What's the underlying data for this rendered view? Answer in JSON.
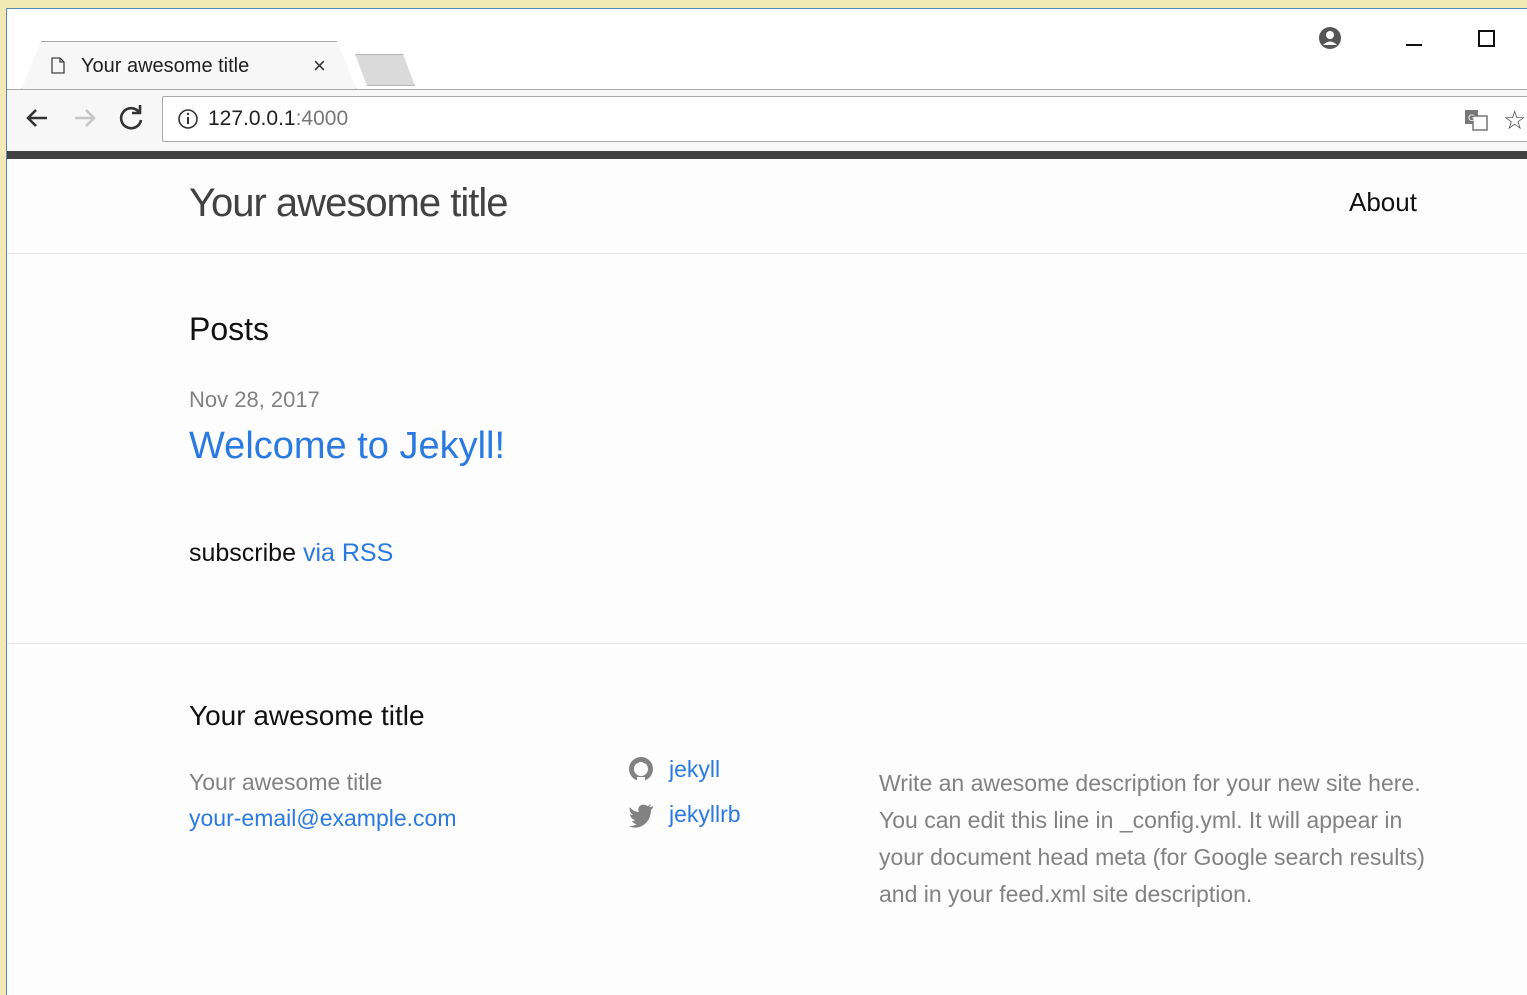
{
  "browser": {
    "tab_title": "Your awesome title",
    "tab_close": "×",
    "url_host": "127.0.0.1",
    "url_port": ":4000",
    "star_glyph": "☆"
  },
  "site": {
    "title": "Your awesome title",
    "nav": [
      {
        "label": "About"
      }
    ],
    "posts_heading": "Posts",
    "posts": [
      {
        "date": "Nov 28, 2017",
        "title": "Welcome to Jekyll!"
      }
    ],
    "subscribe_text": "subscribe",
    "subscribe_link": "via RSS"
  },
  "footer": {
    "heading": "Your awesome title",
    "name": "Your awesome title",
    "email": "your-email@example.com",
    "social": [
      {
        "icon": "github-icon",
        "label": "jekyll"
      },
      {
        "icon": "twitter-icon",
        "label": "jekyllrb"
      }
    ],
    "description": "Write an awesome description for your new site here. You can edit this line in _config.yml. It will appear in your document head meta (for Google search results) and in your feed.xml site description."
  },
  "colors": {
    "link": "#2a7ae2",
    "muted": "#828282",
    "header_bar": "#424242",
    "desktop": "#f1e9b6"
  }
}
